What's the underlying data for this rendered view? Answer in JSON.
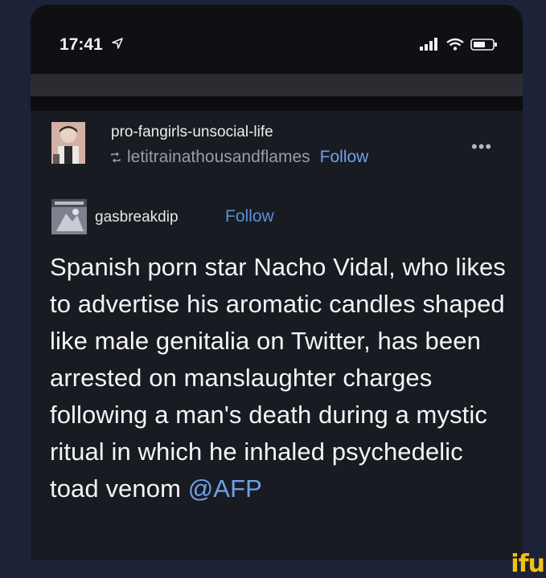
{
  "status_bar": {
    "time": "17:41",
    "icons": [
      "location-arrow-icon",
      "signal-icon",
      "wifi-icon",
      "battery-icon"
    ]
  },
  "post": {
    "poster": "pro-fangirls-unsocial-life",
    "reblogged_from": "letitrainathousandflames",
    "follow_label": "Follow",
    "more_label": "•••",
    "source_user": "gasbreakdip",
    "source_follow_label": "Follow",
    "body_text": "Spanish porn star Nacho Vidal, who likes to advertise his aromatic candles shaped like male genitalia on Twitter, has been arrested on manslaughter charges following a man's death during a mystic ritual in which he inhaled psychedelic toad venom",
    "mention": "@AFP"
  },
  "watermark": "ifu",
  "colors": {
    "background": "#1c2238",
    "card": "#191b22",
    "link": "#6fa0e6",
    "watermark": "#f2c217"
  }
}
